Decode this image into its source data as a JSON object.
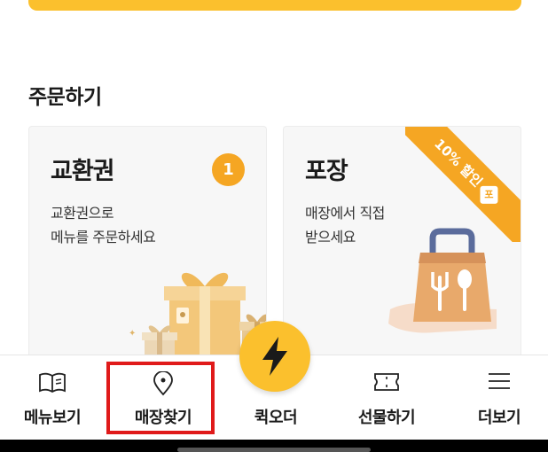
{
  "section": {
    "title": "주문하기"
  },
  "voucher_card": {
    "title": "교환권",
    "badge_count": "1",
    "description_line1": "교환권으로",
    "description_line2": "메뉴를 주문하세요",
    "illustration_icon": "gift-boxes-icon"
  },
  "takeout_card": {
    "title": "포장",
    "description_line1": "매장에서 직접",
    "description_line2": "받으세요",
    "ribbon_text": "10% 할인",
    "ribbon_tag": "포",
    "illustration_icon": "takeout-bag-icon"
  },
  "bottom_nav": {
    "items": [
      {
        "label": "메뉴보기",
        "icon": "book-icon"
      },
      {
        "label": "매장찾기",
        "icon": "location-pin-icon"
      },
      {
        "label": "퀵오더",
        "icon": "lightning-icon"
      },
      {
        "label": "선물하기",
        "icon": "ticket-icon"
      },
      {
        "label": "더보기",
        "icon": "hamburger-menu-icon"
      }
    ]
  },
  "colors": {
    "brand_yellow": "#fbc02d",
    "badge_orange": "#f5a623",
    "highlight_red": "#e01a1a",
    "card_bg": "#f7f7f7"
  }
}
